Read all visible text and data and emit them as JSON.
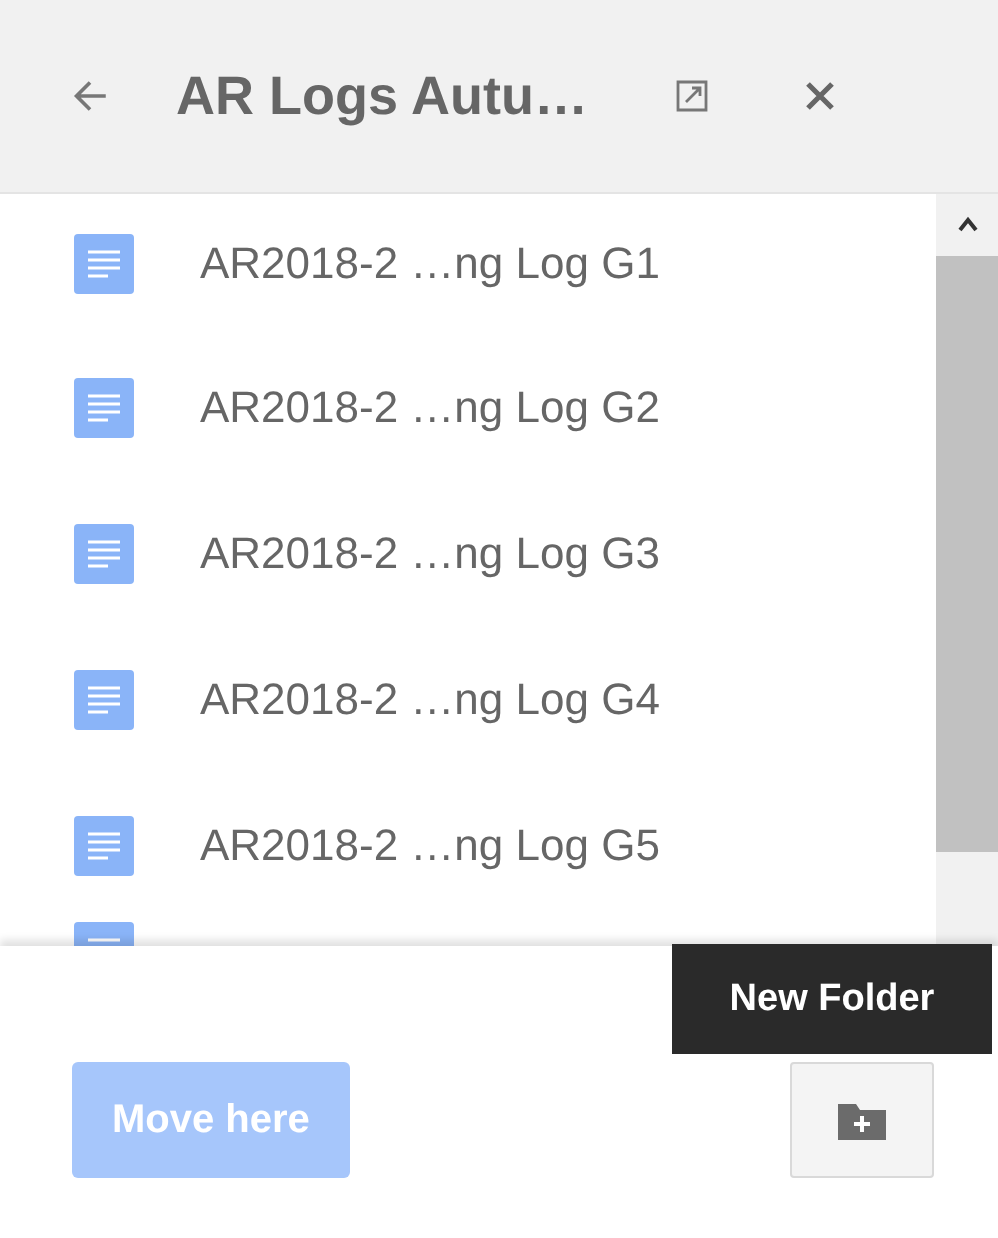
{
  "header": {
    "title": "AR Logs Autu…"
  },
  "files": [
    {
      "name": "AR2018-2 …ng Log G1"
    },
    {
      "name": "AR2018-2 …ng Log G2"
    },
    {
      "name": "AR2018-2 …ng Log G3"
    },
    {
      "name": "AR2018-2 …ng Log G4"
    },
    {
      "name": "AR2018-2 …ng Log G5"
    }
  ],
  "footer": {
    "move_button": {
      "label": "Move here",
      "disabled": true
    },
    "tooltip": "New Folder"
  }
}
